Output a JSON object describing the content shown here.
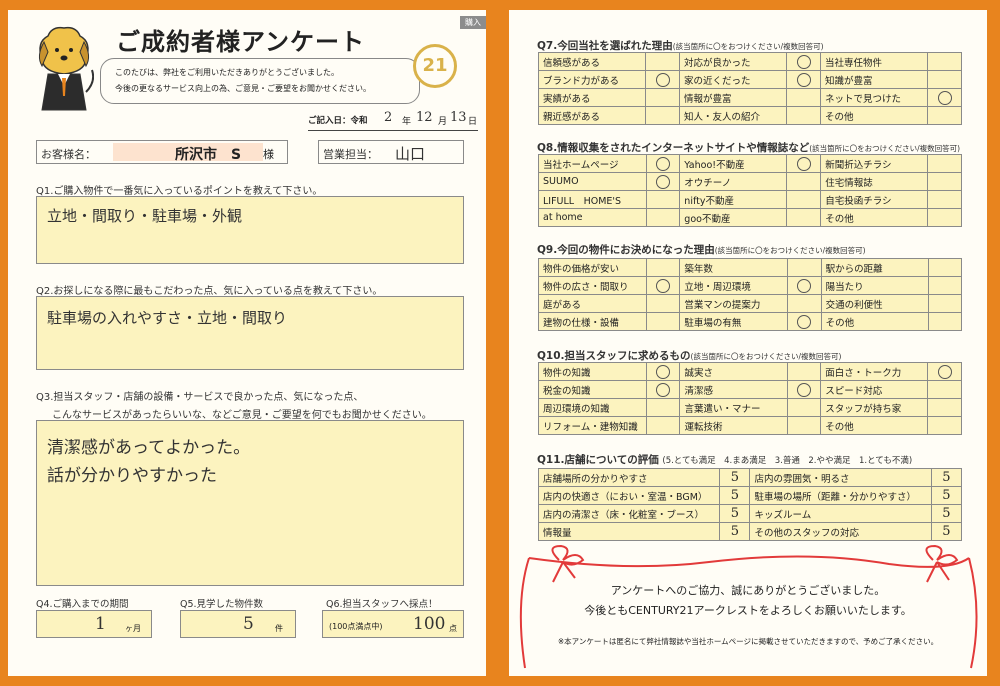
{
  "header": {
    "title": "ご成約者様アンケート",
    "badge": "購入",
    "intro_line1": "このたびは、弊社をご利用いただきありがとうございました。",
    "intro_line2": "今後の更なるサービス向上の為、ご意見・ご要望をお聞かせください。",
    "logo_text": "21",
    "date_label": "ご記入日：令和",
    "date_year": "2",
    "date_month": "12",
    "date_day": "13",
    "u_year": "年",
    "u_month": "月",
    "u_day": "日"
  },
  "customer": {
    "label": "お客様名：",
    "name": "所沢市　S",
    "suffix": "様"
  },
  "sales": {
    "label": "営業担当：",
    "name": "山口"
  },
  "q1": {
    "question": "Q1.ご購入物件で一番気に入っているポイントを教えて下さい。",
    "answer": "立地・間取り・駐車場・外観"
  },
  "q2": {
    "question": "Q2.お探しになる際に最もこだわった点、気に入っている点を教えて下さい。",
    "answer": "駐車場の入れやすさ・立地・間取り"
  },
  "q3": {
    "question_line1": "Q3.担当スタッフ・店舗の設備・サービスで良かった点、気になった点、",
    "question_line2": "こんなサービスがあったらいいな、などご意見・ご要望を何でもお聞かせください。",
    "answer_line1": "清潔感があってよかった。",
    "answer_line2": "話が分かりやすかった"
  },
  "q4": {
    "question": "Q4.ご購入までの期間",
    "answer": "1",
    "unit": "ヶ月"
  },
  "q5": {
    "question": "Q5.見学した物件数",
    "answer": "5",
    "unit": "件"
  },
  "q6": {
    "question": "Q6.担当スタッフへ採点！",
    "note": "(100点満点中)",
    "answer": "100",
    "unit": "点"
  },
  "q7": {
    "title": "Q7.今回当社を選ばれた理由",
    "note": "(該当箇所に〇をおつけください/複数回答可)",
    "rows": [
      [
        {
          "label": "信頼感がある",
          "mark": false
        },
        {
          "label": "対応が良かった",
          "mark": true
        },
        {
          "label": "当社専任物件",
          "mark": false
        }
      ],
      [
        {
          "label": "ブランド力がある",
          "mark": true
        },
        {
          "label": "家の近くだった",
          "mark": true
        },
        {
          "label": "知識が豊富",
          "mark": false
        }
      ],
      [
        {
          "label": "実績がある",
          "mark": false
        },
        {
          "label": "情報が豊富",
          "mark": false
        },
        {
          "label": "ネットで見つけた",
          "mark": true
        }
      ],
      [
        {
          "label": "親近感がある",
          "mark": false
        },
        {
          "label": "知人・友人の紹介",
          "mark": false
        },
        {
          "label": "その他",
          "mark": false
        }
      ]
    ]
  },
  "q8": {
    "title": "Q8.情報収集をされたインターネットサイトや情報誌など",
    "note": "(該当箇所に〇をおつけください/複数回答可)",
    "rows": [
      [
        {
          "label": "当社ホームページ",
          "mark": true
        },
        {
          "label": "Yahoo!不動産",
          "mark": true
        },
        {
          "label": "新聞折込チラシ",
          "mark": false
        }
      ],
      [
        {
          "label": "SUUMO",
          "mark": true
        },
        {
          "label": "オウチーノ",
          "mark": false
        },
        {
          "label": "住宅情報誌",
          "mark": false
        }
      ],
      [
        {
          "label": "LIFULL　HOME'S",
          "mark": false
        },
        {
          "label": "nifty不動産",
          "mark": false
        },
        {
          "label": "自宅投函チラシ",
          "mark": false
        }
      ],
      [
        {
          "label": "at home",
          "mark": false
        },
        {
          "label": "goo不動産",
          "mark": false
        },
        {
          "label": "その他",
          "mark": false
        }
      ]
    ]
  },
  "q9": {
    "title": "Q9.今回の物件にお決めになった理由",
    "note": "(該当箇所に〇をおつけください/複数回答可)",
    "rows": [
      [
        {
          "label": "物件の価格が安い",
          "mark": false
        },
        {
          "label": "築年数",
          "mark": false
        },
        {
          "label": "駅からの距離",
          "mark": false
        }
      ],
      [
        {
          "label": "物件の広さ・間取り",
          "mark": true
        },
        {
          "label": "立地・周辺環境",
          "mark": true
        },
        {
          "label": "陽当たり",
          "mark": false
        }
      ],
      [
        {
          "label": "庭がある",
          "mark": false
        },
        {
          "label": "営業マンの提案力",
          "mark": false
        },
        {
          "label": "交通の利便性",
          "mark": false
        }
      ],
      [
        {
          "label": "建物の仕様・設備",
          "mark": false
        },
        {
          "label": "駐車場の有無",
          "mark": true
        },
        {
          "label": "その他",
          "mark": false
        }
      ]
    ]
  },
  "q10": {
    "title": "Q10.担当スタッフに求めるもの",
    "note": "(該当箇所に〇をおつけください/複数回答可)",
    "rows": [
      [
        {
          "label": "物件の知識",
          "mark": true
        },
        {
          "label": "誠実さ",
          "mark": false
        },
        {
          "label": "面白さ・トーク力",
          "mark": true
        }
      ],
      [
        {
          "label": "税金の知識",
          "mark": true
        },
        {
          "label": "清潔感",
          "mark": true
        },
        {
          "label": "スピード対応",
          "mark": false
        }
      ],
      [
        {
          "label": "周辺環境の知識",
          "mark": false
        },
        {
          "label": "言葉遣い・マナー",
          "mark": false
        },
        {
          "label": "スタッフが持ち家",
          "mark": false
        }
      ],
      [
        {
          "label": "リフォーム・建物知識",
          "mark": false
        },
        {
          "label": "運転技術",
          "mark": false
        },
        {
          "label": "その他",
          "mark": false
        }
      ]
    ]
  },
  "q11": {
    "title": "Q11.店舗についての評価",
    "scale": "(5.とても満足　4.まあ満足　3.普通　2.やや満足　1.とても不満)",
    "rows": [
      [
        {
          "label": "店舗場所の分かりやすさ",
          "score": "5"
        },
        {
          "label": "店内の雰囲気・明るさ",
          "score": "5"
        }
      ],
      [
        {
          "label": "店内の快適さ（におい・室温・BGM）",
          "score": "5"
        },
        {
          "label": "駐車場の場所（距離・分かりやすさ）",
          "score": "5"
        }
      ],
      [
        {
          "label": "店内の清潔さ（床・化粧室・ブース）",
          "score": "5"
        },
        {
          "label": "キッズルーム",
          "score": "5"
        }
      ],
      [
        {
          "label": "情報量",
          "score": "5"
        },
        {
          "label": "その他のスタッフの対応",
          "score": "5"
        }
      ]
    ]
  },
  "footer": {
    "thanks_line1": "アンケートへのご協力、誠にありがとうございました。",
    "thanks_line2": "今後ともCENTURY21アークレストをよろしくお願いいたします。",
    "note": "※本アンケートは匿名にて弊社情報誌や当社ホームページに掲載させていただきますので、予めご了承ください。"
  },
  "colors": {
    "frame": "#e8841e",
    "answer_fill": "#fcf3bf",
    "ribbon": "#e23a3a",
    "logo_gold": "#d9b24a"
  }
}
